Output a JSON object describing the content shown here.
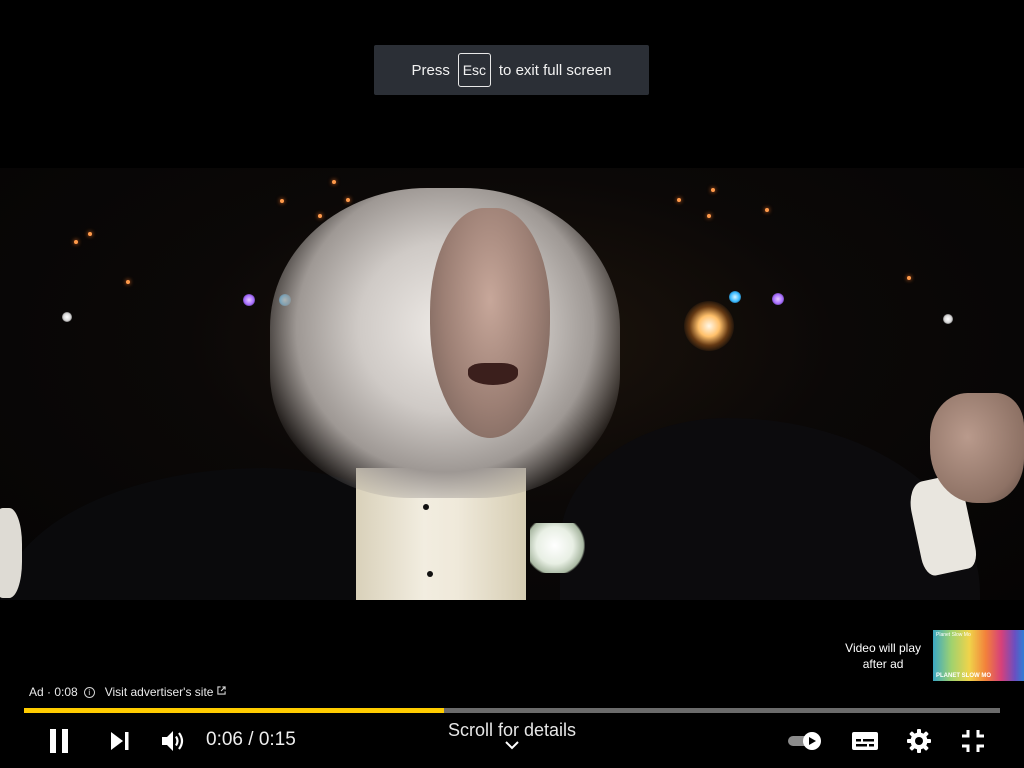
{
  "fullscreen_toast": {
    "before": "Press",
    "key": "Esc",
    "after": "to exit full screen"
  },
  "up_next": {
    "text_line1": "Video will play",
    "text_line2": "after ad",
    "thumbnail_caption": "PLANET SLOW MO",
    "thumbnail_tag": "Planet Slow Mo"
  },
  "ad": {
    "badge": "Ad · 0:08",
    "visit_label": "Visit advertiser's site",
    "info_icon": "info-icon",
    "external_icon": "external-link-icon"
  },
  "player": {
    "progress_fraction": 0.43,
    "progress_color": "#ffcc00",
    "time_current": "0:06",
    "time_total": "0:15",
    "time_text": "0:06 / 0:15",
    "scroll_label": "Scroll for details",
    "icons": [
      "pause-icon",
      "next-icon",
      "volume-icon",
      "autoplay-toggle-icon",
      "subtitles-icon",
      "settings-icon",
      "exit-fullscreen-icon"
    ]
  }
}
